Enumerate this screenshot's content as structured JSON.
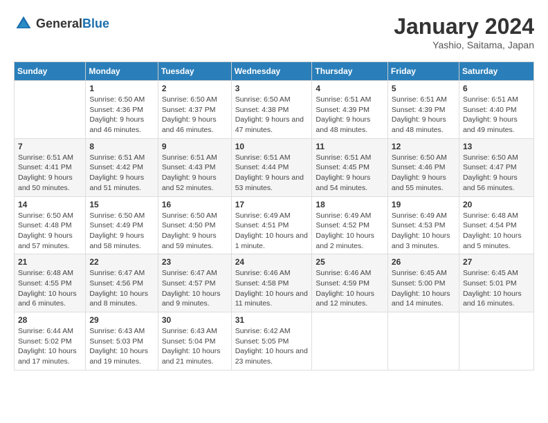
{
  "header": {
    "logo_general": "General",
    "logo_blue": "Blue",
    "month": "January 2024",
    "location": "Yashio, Saitama, Japan"
  },
  "weekdays": [
    "Sunday",
    "Monday",
    "Tuesday",
    "Wednesday",
    "Thursday",
    "Friday",
    "Saturday"
  ],
  "weeks": [
    [
      {
        "day": "",
        "sunrise": "",
        "sunset": "",
        "daylight": ""
      },
      {
        "day": "1",
        "sunrise": "6:50 AM",
        "sunset": "4:36 PM",
        "daylight": "9 hours and 46 minutes."
      },
      {
        "day": "2",
        "sunrise": "6:50 AM",
        "sunset": "4:37 PM",
        "daylight": "9 hours and 46 minutes."
      },
      {
        "day": "3",
        "sunrise": "6:50 AM",
        "sunset": "4:38 PM",
        "daylight": "9 hours and 47 minutes."
      },
      {
        "day": "4",
        "sunrise": "6:51 AM",
        "sunset": "4:39 PM",
        "daylight": "9 hours and 48 minutes."
      },
      {
        "day": "5",
        "sunrise": "6:51 AM",
        "sunset": "4:39 PM",
        "daylight": "9 hours and 48 minutes."
      },
      {
        "day": "6",
        "sunrise": "6:51 AM",
        "sunset": "4:40 PM",
        "daylight": "9 hours and 49 minutes."
      }
    ],
    [
      {
        "day": "7",
        "sunrise": "6:51 AM",
        "sunset": "4:41 PM",
        "daylight": "9 hours and 50 minutes."
      },
      {
        "day": "8",
        "sunrise": "6:51 AM",
        "sunset": "4:42 PM",
        "daylight": "9 hours and 51 minutes."
      },
      {
        "day": "9",
        "sunrise": "6:51 AM",
        "sunset": "4:43 PM",
        "daylight": "9 hours and 52 minutes."
      },
      {
        "day": "10",
        "sunrise": "6:51 AM",
        "sunset": "4:44 PM",
        "daylight": "9 hours and 53 minutes."
      },
      {
        "day": "11",
        "sunrise": "6:51 AM",
        "sunset": "4:45 PM",
        "daylight": "9 hours and 54 minutes."
      },
      {
        "day": "12",
        "sunrise": "6:50 AM",
        "sunset": "4:46 PM",
        "daylight": "9 hours and 55 minutes."
      },
      {
        "day": "13",
        "sunrise": "6:50 AM",
        "sunset": "4:47 PM",
        "daylight": "9 hours and 56 minutes."
      }
    ],
    [
      {
        "day": "14",
        "sunrise": "6:50 AM",
        "sunset": "4:48 PM",
        "daylight": "9 hours and 57 minutes."
      },
      {
        "day": "15",
        "sunrise": "6:50 AM",
        "sunset": "4:49 PM",
        "daylight": "9 hours and 58 minutes."
      },
      {
        "day": "16",
        "sunrise": "6:50 AM",
        "sunset": "4:50 PM",
        "daylight": "9 hours and 59 minutes."
      },
      {
        "day": "17",
        "sunrise": "6:49 AM",
        "sunset": "4:51 PM",
        "daylight": "10 hours and 1 minute."
      },
      {
        "day": "18",
        "sunrise": "6:49 AM",
        "sunset": "4:52 PM",
        "daylight": "10 hours and 2 minutes."
      },
      {
        "day": "19",
        "sunrise": "6:49 AM",
        "sunset": "4:53 PM",
        "daylight": "10 hours and 3 minutes."
      },
      {
        "day": "20",
        "sunrise": "6:48 AM",
        "sunset": "4:54 PM",
        "daylight": "10 hours and 5 minutes."
      }
    ],
    [
      {
        "day": "21",
        "sunrise": "6:48 AM",
        "sunset": "4:55 PM",
        "daylight": "10 hours and 6 minutes."
      },
      {
        "day": "22",
        "sunrise": "6:47 AM",
        "sunset": "4:56 PM",
        "daylight": "10 hours and 8 minutes."
      },
      {
        "day": "23",
        "sunrise": "6:47 AM",
        "sunset": "4:57 PM",
        "daylight": "10 hours and 9 minutes."
      },
      {
        "day": "24",
        "sunrise": "6:46 AM",
        "sunset": "4:58 PM",
        "daylight": "10 hours and 11 minutes."
      },
      {
        "day": "25",
        "sunrise": "6:46 AM",
        "sunset": "4:59 PM",
        "daylight": "10 hours and 12 minutes."
      },
      {
        "day": "26",
        "sunrise": "6:45 AM",
        "sunset": "5:00 PM",
        "daylight": "10 hours and 14 minutes."
      },
      {
        "day": "27",
        "sunrise": "6:45 AM",
        "sunset": "5:01 PM",
        "daylight": "10 hours and 16 minutes."
      }
    ],
    [
      {
        "day": "28",
        "sunrise": "6:44 AM",
        "sunset": "5:02 PM",
        "daylight": "10 hours and 17 minutes."
      },
      {
        "day": "29",
        "sunrise": "6:43 AM",
        "sunset": "5:03 PM",
        "daylight": "10 hours and 19 minutes."
      },
      {
        "day": "30",
        "sunrise": "6:43 AM",
        "sunset": "5:04 PM",
        "daylight": "10 hours and 21 minutes."
      },
      {
        "day": "31",
        "sunrise": "6:42 AM",
        "sunset": "5:05 PM",
        "daylight": "10 hours and 23 minutes."
      },
      {
        "day": "",
        "sunrise": "",
        "sunset": "",
        "daylight": ""
      },
      {
        "day": "",
        "sunrise": "",
        "sunset": "",
        "daylight": ""
      },
      {
        "day": "",
        "sunrise": "",
        "sunset": "",
        "daylight": ""
      }
    ]
  ]
}
